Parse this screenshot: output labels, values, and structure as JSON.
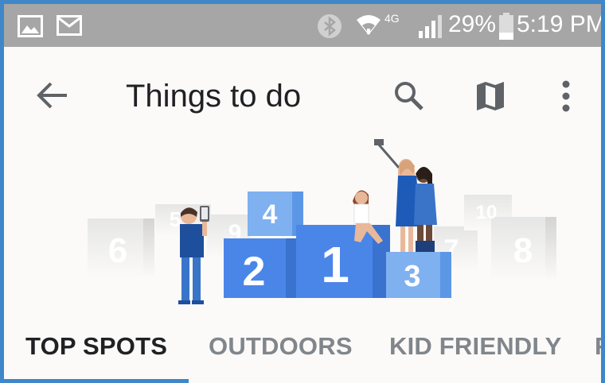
{
  "status_bar": {
    "battery_percent": "29%",
    "time": "5:19 PM",
    "network": "4G",
    "battery_level": 0.29,
    "icons": [
      "gallery-icon",
      "email-icon",
      "bluetooth-icon",
      "wifi-icon",
      "signal-icon",
      "battery-icon"
    ]
  },
  "app_bar": {
    "title": "Things to do",
    "icons": [
      "back-arrow-icon",
      "search-icon",
      "map-icon",
      "more-vert-icon"
    ]
  },
  "illustration": {
    "podium_numbers": [
      "1",
      "2",
      "3",
      "4"
    ],
    "background_numbers": [
      "6",
      "5",
      "9",
      "7",
      "10",
      "8"
    ]
  },
  "tabs": [
    {
      "label": "TOP SPOTS",
      "active": true
    },
    {
      "label": "OUTDOORS",
      "active": false
    },
    {
      "label": "KID FRIENDLY",
      "active": false
    },
    {
      "label": "F",
      "active": false
    }
  ],
  "colors": {
    "accent": "#3f87c8",
    "status_bar": "#a6a6a6",
    "podium_blue": "#4a86e8",
    "podium_light": "#7fb0f0"
  }
}
